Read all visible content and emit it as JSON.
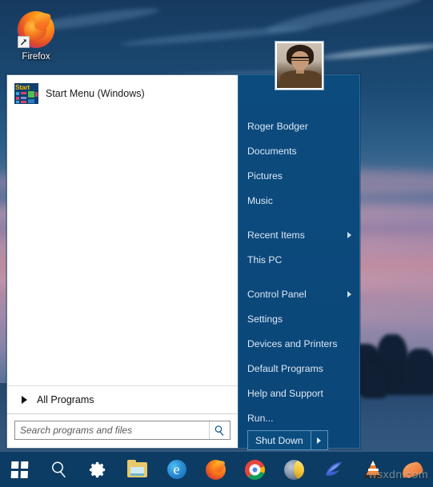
{
  "desktop": {
    "icons": [
      {
        "label": "Firefox",
        "icon": "firefox-icon",
        "shortcut": true
      }
    ]
  },
  "start_menu": {
    "pinned_items": [
      {
        "label": "Start Menu (Windows)",
        "icon": "start-menu-tile-icon",
        "tile_word": "Start"
      }
    ],
    "all_programs": {
      "label": "All Programs",
      "icon": "right-arrow-icon"
    },
    "search": {
      "placeholder": "Search programs and files",
      "value": "",
      "icon": "search-icon"
    },
    "user": {
      "name": "Roger Bodger",
      "avatar": "user-avatar"
    },
    "right_groups": [
      [
        {
          "label": "Roger Bodger",
          "submenu": false
        },
        {
          "label": "Documents",
          "submenu": false
        },
        {
          "label": "Pictures",
          "submenu": false
        },
        {
          "label": "Music",
          "submenu": false
        }
      ],
      [
        {
          "label": "Recent Items",
          "submenu": true
        },
        {
          "label": "This PC",
          "submenu": false
        }
      ],
      [
        {
          "label": "Control Panel",
          "submenu": true
        },
        {
          "label": "Settings",
          "submenu": false
        },
        {
          "label": "Devices and Printers",
          "submenu": false
        },
        {
          "label": "Default Programs",
          "submenu": false
        },
        {
          "label": "Help and Support",
          "submenu": false
        },
        {
          "label": "Run...",
          "submenu": false
        }
      ]
    ],
    "shutdown": {
      "label": "Shut Down",
      "arrow_icon": "chevron-right-icon"
    }
  },
  "taskbar": {
    "items": [
      {
        "name": "start-button",
        "icon": "windows-logo-icon"
      },
      {
        "name": "taskbar-search",
        "icon": "search-icon"
      },
      {
        "name": "taskbar-settings",
        "icon": "gear-icon"
      },
      {
        "name": "taskbar-file-explorer",
        "icon": "folder-icon"
      },
      {
        "name": "taskbar-edge",
        "icon": "edge-icon",
        "glyph": "e"
      },
      {
        "name": "taskbar-firefox",
        "icon": "firefox-icon"
      },
      {
        "name": "taskbar-chrome",
        "icon": "chrome-icon"
      },
      {
        "name": "taskbar-seamonkey",
        "icon": "seamonkey-icon"
      },
      {
        "name": "taskbar-swoosh-app",
        "icon": "blue-swoosh-icon"
      },
      {
        "name": "taskbar-vlc",
        "icon": "vlc-cone-icon"
      },
      {
        "name": "taskbar-mango-app",
        "icon": "orange-crescent-icon"
      }
    ]
  },
  "watermark": {
    "text": "wsxdn.com"
  },
  "colors": {
    "menu_blue": "#0c4b7e",
    "menu_text": "#dce9f5",
    "accent_border": "#5d94bb",
    "pane_white": "#ffffff",
    "taskbar": "#0c3c63"
  }
}
